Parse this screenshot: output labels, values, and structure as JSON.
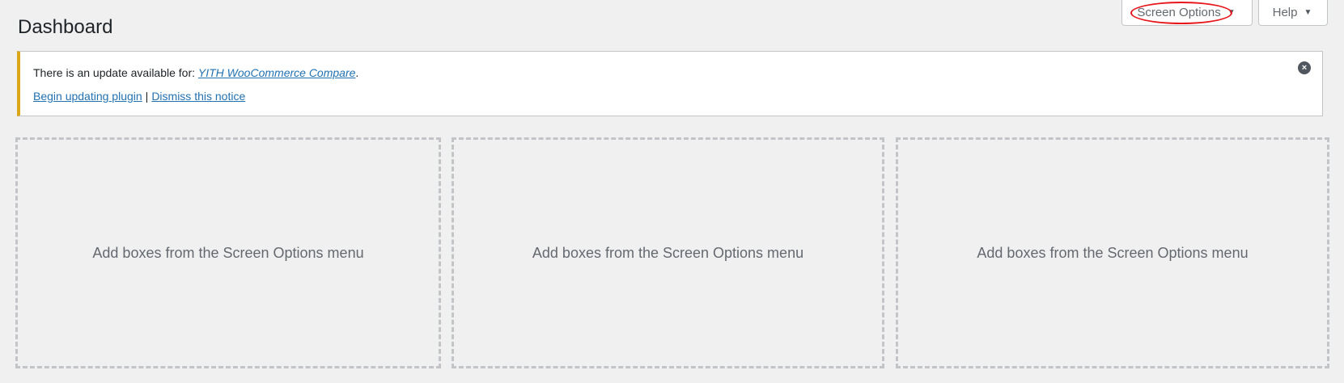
{
  "header": {
    "title": "Dashboard",
    "screen_options_label": "Screen Options",
    "help_label": "Help",
    "caret": "▼"
  },
  "notice": {
    "prefix": "There is an update available for: ",
    "plugin_name": "YITH WooCommerce Compare",
    "suffix": ".",
    "begin_update_label": "Begin updating plugin",
    "separator": "|",
    "dismiss_label": "Dismiss this notice",
    "dismiss_icon": "close-circle-icon",
    "accent_color": "#dba617"
  },
  "dropzones": [
    {
      "text": "Add boxes from the Screen Options menu"
    },
    {
      "text": "Add boxes from the Screen Options menu"
    },
    {
      "text": "Add boxes from the Screen Options menu"
    }
  ],
  "annotation": {
    "color": "#e8151b",
    "shape": "ellipse"
  }
}
